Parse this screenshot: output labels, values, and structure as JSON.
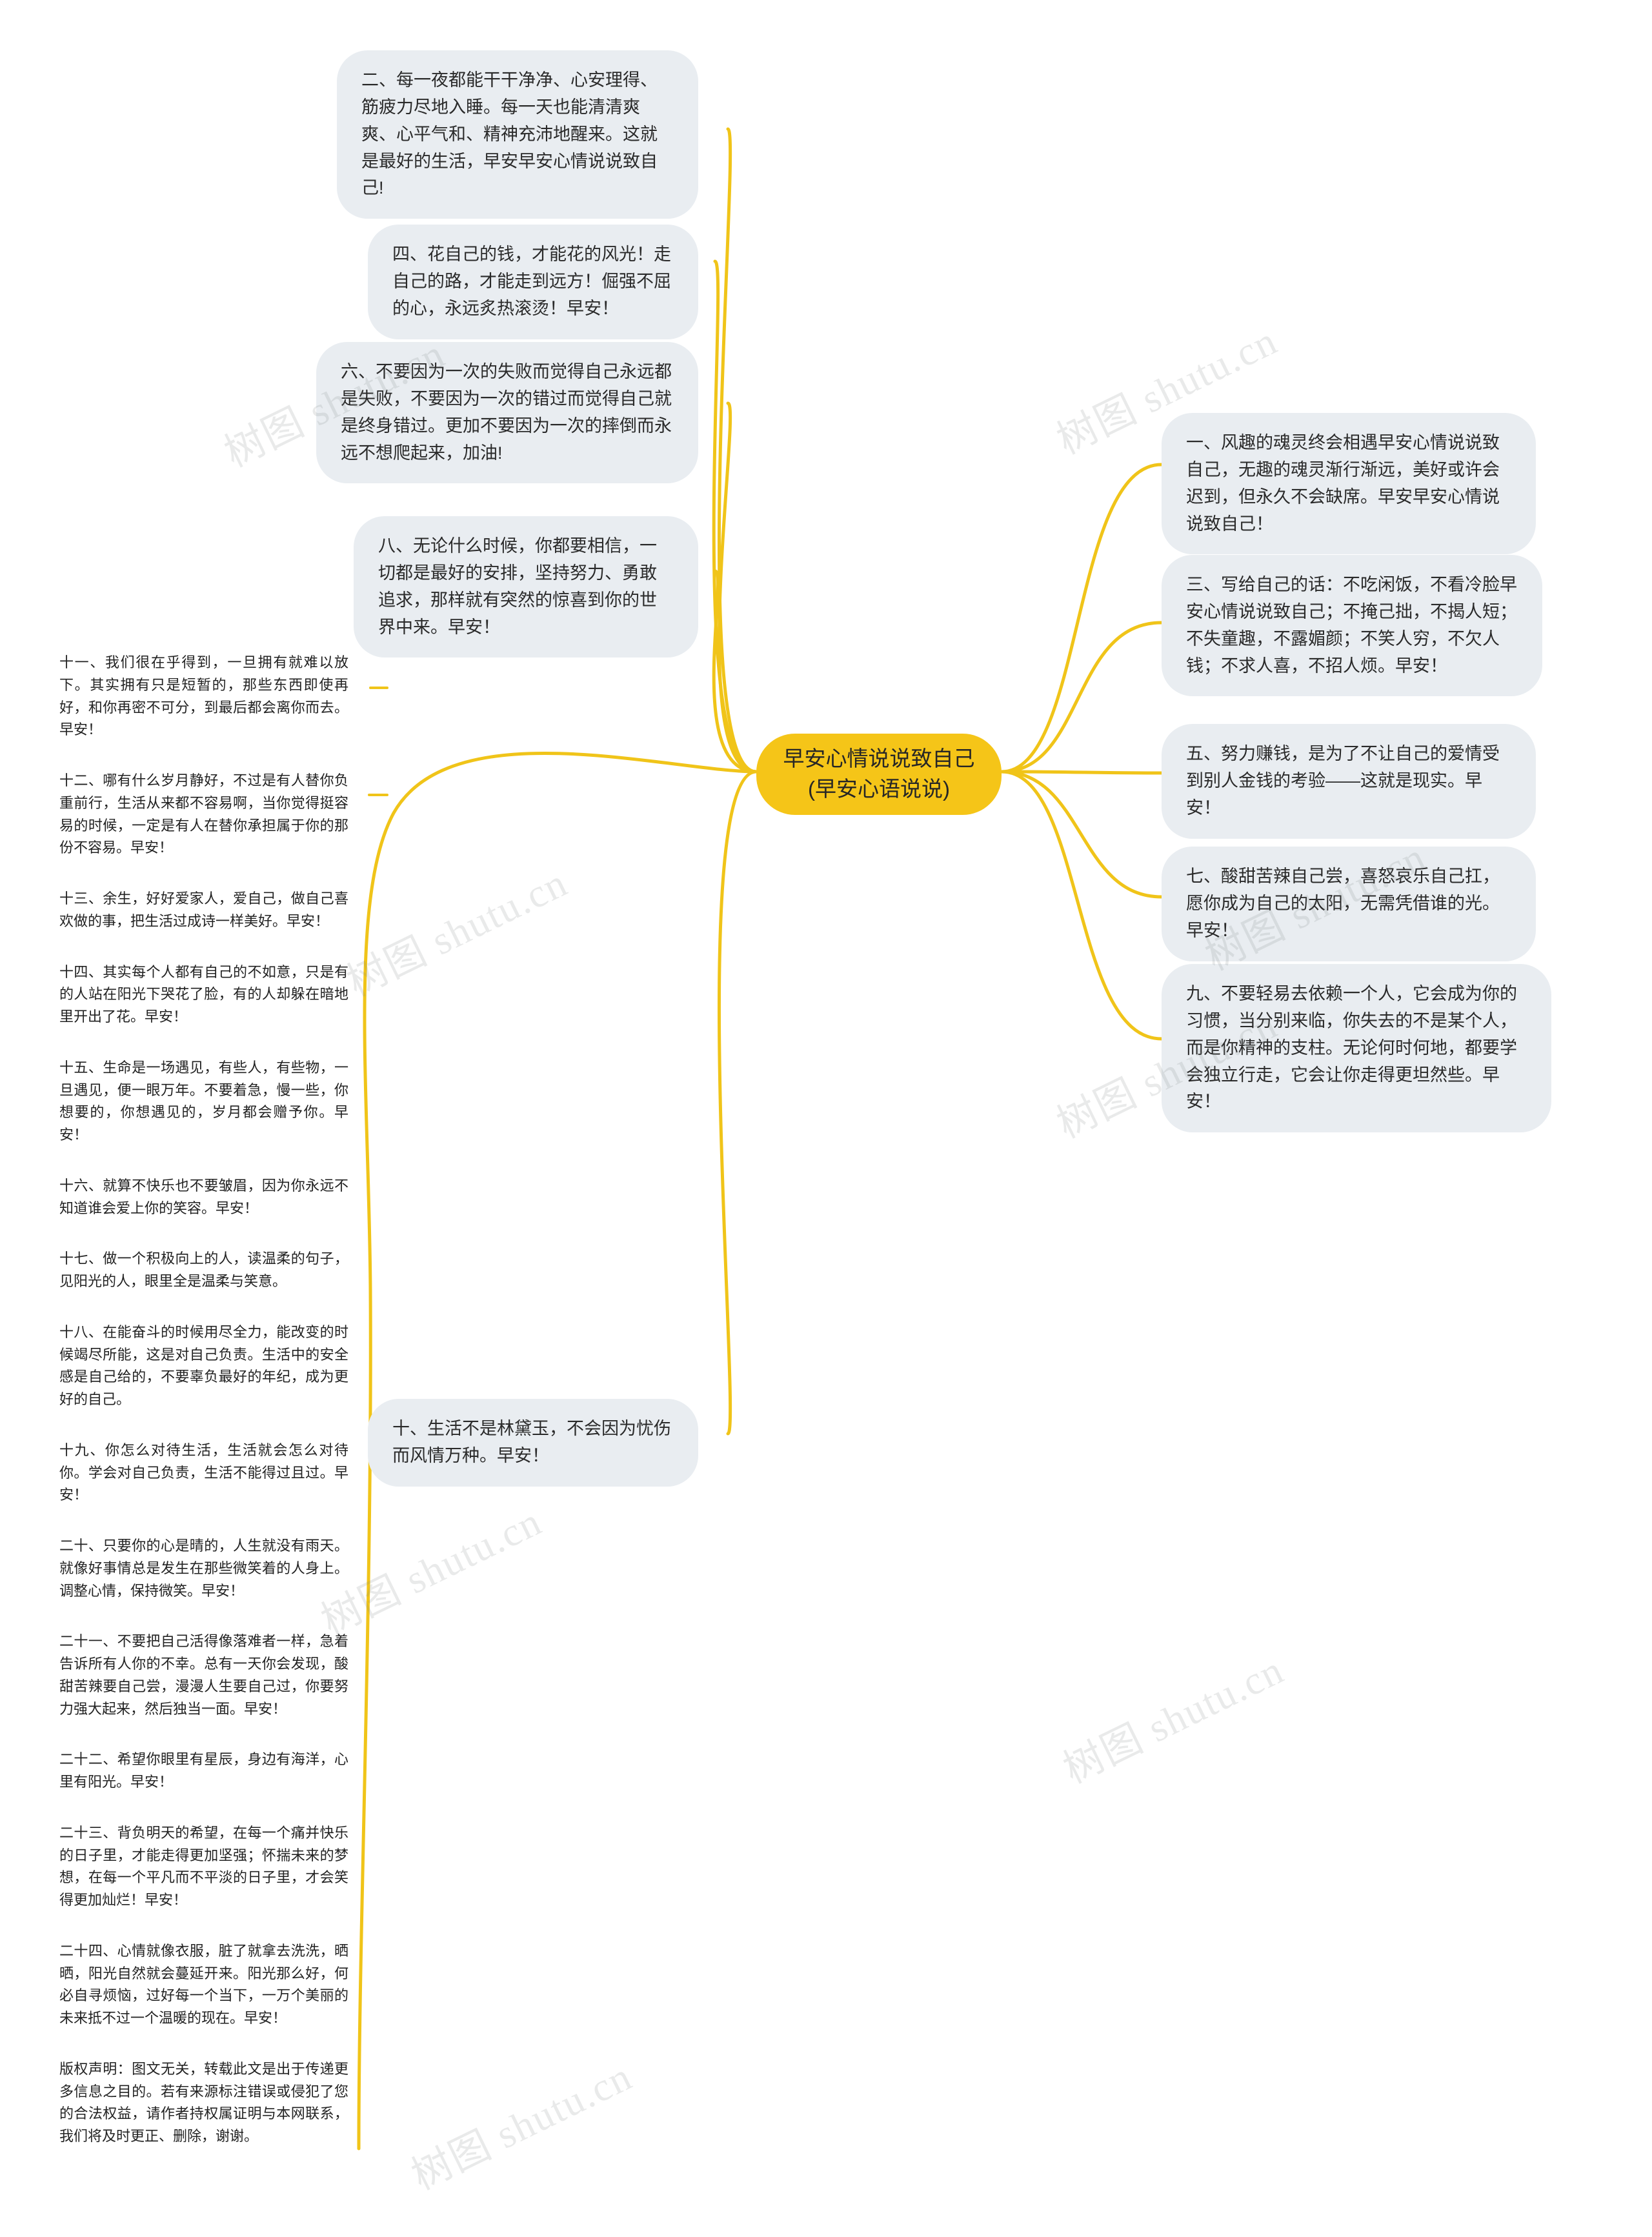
{
  "central": {
    "title": "早安心情说说致自己(早安心语说说)",
    "color": "#f5c518"
  },
  "theme": {
    "branch_color": "#f0c419",
    "bubble_bg": "#e9edf1",
    "text_color": "#2a2a2a",
    "page_bg": "#ffffff"
  },
  "branches_left": [
    {
      "id": "item-2",
      "text": "二、每一夜都能干干净净、心安理得、筋疲力尽地入睡。每一天也能清清爽爽、心平气和、精神充沛地醒来。这就是最好的生活，早安早安心情说说致自己!"
    },
    {
      "id": "item-4",
      "text": "四、花自己的钱，才能花的风光！走自己的路，才能走到远方！倔强不屈的心，永远炙热滚烫！早安！"
    },
    {
      "id": "item-6",
      "text": "六、不要因为一次的失败而觉得自己永远都是失败，不要因为一次的错过而觉得自己就是终身错过。更加不要因为一次的摔倒而永远不想爬起来，加油!"
    },
    {
      "id": "item-8",
      "text": "八、无论什么时候，你都要相信，一切都是最好的安排，坚持努力、勇敢追求，那样就有突然的惊喜到你的世界中来。早安！"
    },
    {
      "id": "item-10",
      "text": "十、生活不是林黛玉，不会因为忧伤而风情万种。早安！"
    }
  ],
  "branches_right": [
    {
      "id": "item-1",
      "text": "一、风趣的魂灵终会相遇早安心情说说致自己，无趣的魂灵渐行渐远，美好或许会迟到，但永久不会缺席。早安早安心情说说致自己！"
    },
    {
      "id": "item-3",
      "text": "三、写给自己的话：不吃闲饭，不看冷脸早安心情说说致自己；不掩己拙，不揭人短；不失童趣，不露媚颜；不笑人穷，不欠人钱；不求人喜，不招人烦。早安！"
    },
    {
      "id": "item-5",
      "text": "五、努力赚钱，是为了不让自己的爱情受到别人金钱的考验——这就是现实。早安！"
    },
    {
      "id": "item-7",
      "text": "七、酸甜苦辣自己尝，喜怒哀乐自己扛，愿你成为自己的太阳，无需凭借谁的光。早安！"
    },
    {
      "id": "item-9",
      "text": "九、不要轻易去依赖一个人，它会成为你的习惯，当分别来临，你失去的不是某个人，而是你精神的支柱。无论何时何地，都要学会独立行走，它会让你走得更坦然些。早安！"
    }
  ],
  "list_column": [
    {
      "id": "item-11",
      "text": "十一、我们很在乎得到，一旦拥有就难以放下。其实拥有只是短暂的，那些东西即使再好，和你再密不可分，到最后都会离你而去。早安！"
    },
    {
      "id": "item-12",
      "text": "十二、哪有什么岁月静好，不过是有人替你负重前行，生活从来都不容易啊，当你觉得挺容易的时候，一定是有人在替你承担属于你的那份不容易。早安！"
    },
    {
      "id": "item-13",
      "text": "十三、余生，好好爱家人，爱自己，做自己喜欢做的事，把生活过成诗一样美好。早安！"
    },
    {
      "id": "item-14",
      "text": "十四、其实每个人都有自己的不如意，只是有的人站在阳光下哭花了脸，有的人却躲在暗地里开出了花。早安！"
    },
    {
      "id": "item-15",
      "text": "十五、生命是一场遇见，有些人，有些物，一旦遇见，便一眼万年。不要着急，慢一些，你想要的，你想遇见的，岁月都会赠予你。早安！"
    },
    {
      "id": "item-16",
      "text": "十六、就算不快乐也不要皱眉，因为你永远不知道谁会爱上你的笑容。早安！"
    },
    {
      "id": "item-17",
      "text": "十七、做一个积极向上的人，读温柔的句子，见阳光的人，眼里全是温柔与笑意。"
    },
    {
      "id": "item-18",
      "text": "十八、在能奋斗的时候用尽全力，能改变的时候竭尽所能，这是对自己负责。生活中的安全感是自己给的，不要辜负最好的年纪，成为更好的自己。"
    },
    {
      "id": "item-19",
      "text": "十九、你怎么对待生活，生活就会怎么对待你。学会对自己负责，生活不能得过且过。早安！"
    },
    {
      "id": "item-20",
      "text": "二十、只要你的心是晴的，人生就没有雨天。就像好事情总是发生在那些微笑着的人身上。调整心情，保持微笑。早安！"
    },
    {
      "id": "item-21",
      "text": "二十一、不要把自己活得像落难者一样，急着告诉所有人你的不幸。总有一天你会发现，酸甜苦辣要自己尝，漫漫人生要自己过，你要努力强大起来，然后独当一面。早安！"
    },
    {
      "id": "item-22",
      "text": "二十二、希望你眼里有星辰，身边有海洋，心里有阳光。早安！"
    },
    {
      "id": "item-23",
      "text": "二十三、背负明天的希望，在每一个痛并快乐的日子里，才能走得更加坚强；怀揣未来的梦想，在每一个平凡而不平淡的日子里，才会笑得更加灿烂！早安！"
    },
    {
      "id": "item-24",
      "text": "二十四、心情就像衣服，脏了就拿去洗洗，晒晒，阳光自然就会蔓延开来。阳光那么好，何必自寻烦恼，过好每一个当下，一万个美丽的未来抵不过一个温暖的现在。早安！"
    },
    {
      "id": "disclaimer",
      "text": "版权声明：图文无关，转载此文是出于传递更多信息之目的。若有来源标注错误或侵犯了您的合法权益，请作者持权属证明与本网联系，我们将及时更正、删除，谢谢。"
    }
  ],
  "watermarks": [
    {
      "text": "树图 shutu.cn"
    },
    {
      "text": "树图 shutu.cn"
    },
    {
      "text": "树图 shutu.cn"
    },
    {
      "text": "树图 shutu.cn"
    },
    {
      "text": "树图 shutu.cn"
    },
    {
      "text": "树图 shutu.cn"
    },
    {
      "text": "树图 shutu.cn"
    },
    {
      "text": "树图 shutu.cn"
    }
  ]
}
